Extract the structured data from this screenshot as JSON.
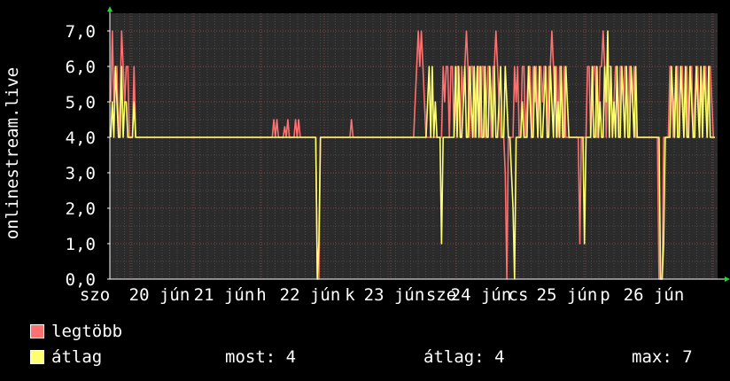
{
  "chart_data": {
    "type": "line",
    "ylabel": "onlinestream.live",
    "ylim": [
      0,
      7.5
    ],
    "yticks": [
      "0,0",
      "1,0",
      "2,0",
      "3,0",
      "4,0",
      "5,0",
      "6,0",
      "7,0"
    ],
    "xtick_labels": [
      "szo",
      "20 jún",
      "21 jún",
      "h",
      "22 jún",
      "k",
      "23 jún",
      "sze",
      "24 jún",
      "cs",
      "25 jún",
      "p",
      "26 jún"
    ],
    "grid": true,
    "background": "#2b2b2b",
    "series": [
      {
        "name": "legtöbb",
        "color": "#ff7070",
        "values": [
          5,
          7,
          5,
          6,
          6,
          4,
          5,
          7,
          6,
          5,
          6,
          6,
          4,
          4,
          4,
          6,
          4,
          4,
          4,
          4,
          4,
          4,
          4,
          4,
          4,
          4,
          4,
          4,
          4,
          4,
          4,
          4,
          4,
          4,
          4,
          4,
          4,
          4,
          4,
          4,
          4,
          4,
          4,
          4,
          4,
          4,
          4,
          4,
          4,
          4,
          4,
          4,
          4,
          4,
          4,
          4,
          4,
          4,
          4,
          4,
          4,
          4,
          4,
          4,
          4,
          4,
          4,
          4,
          4,
          4,
          4,
          4,
          4,
          4,
          4,
          4,
          4,
          4,
          4,
          4,
          4,
          4,
          4,
          4,
          4,
          4,
          4,
          4,
          4,
          4,
          4,
          4,
          4,
          4,
          4,
          4,
          4,
          4,
          4,
          4,
          4,
          4,
          4,
          4,
          4,
          4.5,
          4,
          4.5,
          4,
          4,
          4,
          4,
          4.3,
          4,
          4.5,
          4,
          4,
          4,
          4,
          4.5,
          4,
          4.5,
          4,
          4,
          4,
          4,
          4,
          4,
          4,
          4,
          4,
          4,
          4,
          0,
          0,
          4,
          4,
          4,
          4,
          4,
          4,
          4,
          4,
          4,
          4,
          4,
          4,
          4,
          4,
          4,
          4,
          4,
          4,
          4,
          4,
          4.5,
          4,
          4,
          4,
          4,
          4,
          4,
          4,
          4,
          4,
          4,
          4,
          4,
          4,
          4,
          4,
          4,
          4,
          4,
          4,
          4,
          4,
          4,
          4,
          4,
          4,
          4,
          4,
          4,
          4,
          4,
          4,
          4,
          4,
          4,
          4,
          4,
          4,
          4,
          4,
          4,
          5,
          6,
          7,
          6,
          7,
          6,
          5,
          4,
          4,
          4,
          4,
          4,
          4,
          4,
          4,
          4,
          4,
          4,
          6,
          5,
          6,
          6,
          4,
          6,
          6,
          4,
          5,
          6,
          6,
          4,
          6,
          5,
          6,
          7,
          6,
          4,
          6,
          6,
          4,
          5,
          6,
          6,
          4,
          6,
          6,
          4,
          5,
          6,
          6,
          4,
          6,
          6,
          7,
          6,
          5,
          4,
          4,
          4,
          3,
          0,
          4,
          4,
          4,
          4,
          6,
          5,
          6,
          4,
          4,
          6,
          6,
          4,
          5,
          6,
          6,
          4,
          6,
          5,
          6,
          4,
          6,
          6,
          5,
          6,
          6,
          4,
          6,
          6,
          7,
          6,
          5,
          6,
          4,
          6,
          6,
          4,
          6,
          4,
          4,
          4,
          4,
          4,
          4,
          4,
          4,
          4,
          1,
          4,
          4,
          4,
          4,
          6,
          6,
          4,
          5,
          6,
          6,
          4,
          4,
          6,
          6,
          7,
          6,
          4,
          6,
          6,
          6,
          4,
          5,
          6,
          6,
          4,
          6,
          6,
          5,
          6,
          6,
          4,
          6,
          6,
          5,
          6,
          4,
          4,
          4,
          4,
          4,
          4,
          4,
          4,
          4,
          4,
          4,
          4,
          4,
          4,
          4,
          0,
          0,
          0,
          4,
          4,
          4,
          4,
          6,
          6,
          4,
          5,
          6,
          6,
          4,
          6,
          6,
          4,
          5,
          6,
          4,
          6,
          6,
          4,
          5,
          6,
          6,
          4,
          6,
          5,
          6,
          6,
          4,
          6,
          6,
          5,
          4,
          4
        ],
        "avg_values": [
          4,
          5,
          4,
          6,
          5,
          4,
          4,
          6,
          4,
          5,
          5,
          4,
          4,
          4,
          4,
          5,
          4,
          4,
          4,
          4,
          4,
          4,
          4,
          4,
          4,
          4,
          4,
          4,
          4,
          4,
          4,
          4,
          4,
          4,
          4,
          4,
          4,
          4,
          4,
          4,
          4,
          4,
          4,
          4,
          4,
          4,
          4,
          4,
          4,
          4,
          4,
          4,
          4,
          4,
          4,
          4,
          4,
          4,
          4,
          4,
          4,
          4,
          4,
          4,
          4,
          4,
          4,
          4,
          4,
          4,
          4,
          4,
          4,
          4,
          4,
          4,
          4,
          4,
          4,
          4,
          4,
          4,
          4,
          4,
          4,
          4,
          4,
          4,
          4,
          4,
          4,
          4,
          4,
          4,
          4,
          4,
          4,
          4,
          4,
          4,
          4,
          4,
          4,
          4,
          4,
          4,
          4,
          4,
          4,
          4,
          4,
          4,
          4,
          4,
          4,
          4,
          4,
          4,
          4,
          4,
          4,
          4,
          4,
          4,
          4,
          4,
          4,
          4,
          4,
          4,
          4,
          4,
          4,
          0,
          1,
          4,
          4,
          4,
          4,
          4,
          4,
          4,
          4,
          4,
          4,
          4,
          4,
          4,
          4,
          4,
          4,
          4,
          4,
          4,
          4,
          4,
          4,
          4,
          4,
          4,
          4,
          4,
          4,
          4,
          4,
          4,
          4,
          4,
          4,
          4,
          4,
          4,
          4,
          4,
          4,
          4,
          4,
          4,
          4,
          4,
          4,
          4,
          4,
          4,
          4,
          4,
          4,
          4,
          4,
          4,
          4,
          4,
          4,
          4,
          4,
          4,
          4,
          4,
          4,
          4,
          4,
          4,
          4,
          4,
          5,
          6,
          4,
          6,
          4,
          5,
          4,
          4,
          4,
          1,
          4,
          4,
          4,
          4,
          4,
          4,
          4,
          4,
          6,
          4,
          6,
          4,
          4,
          5,
          6,
          4,
          4,
          6,
          5,
          4,
          6,
          4,
          6,
          4,
          6,
          4,
          4,
          6,
          4,
          4,
          6,
          5,
          4,
          6,
          4,
          4,
          5,
          6,
          4,
          4,
          6,
          5,
          4,
          4,
          3,
          2,
          0,
          4,
          4,
          4,
          4,
          5,
          4,
          4,
          4,
          6,
          5,
          4,
          4,
          6,
          5,
          4,
          6,
          4,
          4,
          5,
          6,
          4,
          4,
          6,
          5,
          4,
          6,
          4,
          5,
          4,
          6,
          4,
          4,
          6,
          5,
          4,
          4,
          4,
          4,
          4,
          4,
          4,
          4,
          4,
          4,
          1,
          4,
          4,
          4,
          4,
          6,
          4,
          4,
          6,
          4,
          5,
          4,
          4,
          6,
          5,
          7,
          4,
          6,
          4,
          5,
          4,
          6,
          4,
          4,
          6,
          5,
          4,
          6,
          4,
          4,
          6,
          5,
          4,
          6,
          4,
          4,
          4,
          4,
          4,
          4,
          4,
          4,
          4,
          4,
          4,
          4,
          4,
          4,
          4,
          0,
          0,
          1,
          4,
          4,
          4,
          4,
          6,
          5,
          4,
          6,
          4,
          4,
          6,
          5,
          4,
          6,
          4,
          4,
          6,
          5,
          4,
          4,
          6,
          5,
          4,
          6,
          4,
          6,
          5,
          4,
          6,
          4,
          4,
          4,
          4
        ]
      }
    ]
  },
  "legend": {
    "max_label": "legtöbb",
    "avg_label": "átlag",
    "max_color": "#ff7070",
    "avg_color": "#ffff70"
  },
  "stats": {
    "current": "most: 4",
    "average": "átlag: 4",
    "maximum": "max: 7"
  }
}
